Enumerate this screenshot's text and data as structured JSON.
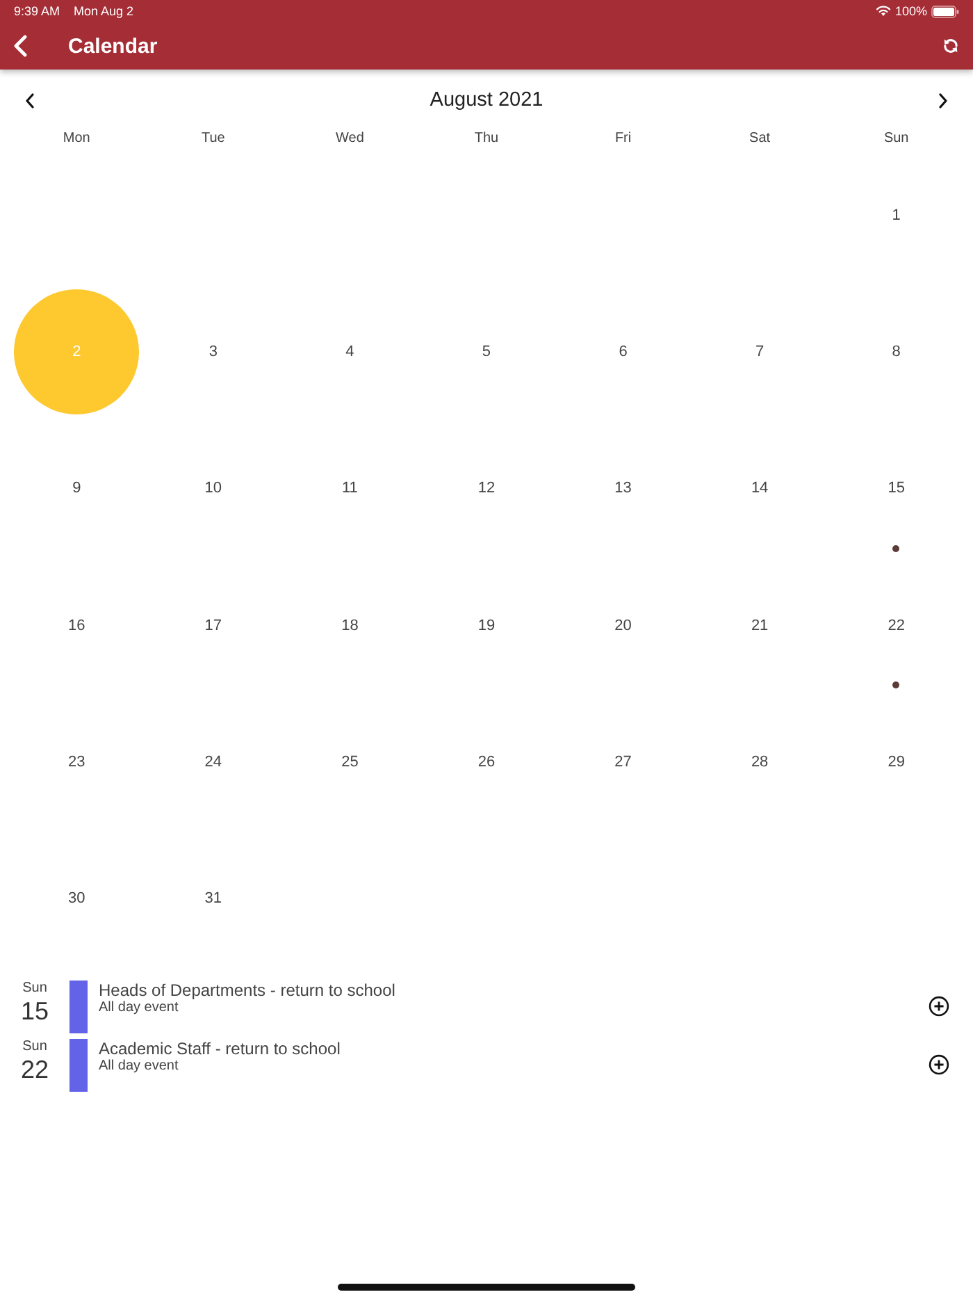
{
  "status_bar": {
    "time": "9:39 AM",
    "date": "Mon Aug 2",
    "battery": "100%"
  },
  "app_bar": {
    "title": "Calendar"
  },
  "calendar": {
    "month": "August 2021",
    "weekdays": [
      "Mon",
      "Tue",
      "Wed",
      "Thu",
      "Fri",
      "Sat",
      "Sun"
    ],
    "weeks": [
      {
        "days": [
          {
            "kind": "blank"
          },
          {
            "kind": "blank"
          },
          {
            "kind": "blank"
          },
          {
            "kind": "blank"
          },
          {
            "kind": "blank"
          },
          {
            "kind": "blank"
          },
          {
            "kind": "date",
            "label": "1",
            "selected": false,
            "has_event": false
          }
        ]
      },
      {
        "days": [
          {
            "kind": "date",
            "label": "2",
            "selected": true,
            "has_event": false
          },
          {
            "kind": "date",
            "label": "3",
            "selected": false,
            "has_event": false
          },
          {
            "kind": "date",
            "label": "4",
            "selected": false,
            "has_event": false
          },
          {
            "kind": "date",
            "label": "5",
            "selected": false,
            "has_event": false
          },
          {
            "kind": "date",
            "label": "6",
            "selected": false,
            "has_event": false
          },
          {
            "kind": "date",
            "label": "7",
            "selected": false,
            "has_event": false
          },
          {
            "kind": "date",
            "label": "8",
            "selected": false,
            "has_event": false
          }
        ]
      },
      {
        "days": [
          {
            "kind": "date",
            "label": "9",
            "selected": false,
            "has_event": false
          },
          {
            "kind": "date",
            "label": "10",
            "selected": false,
            "has_event": false
          },
          {
            "kind": "date",
            "label": "11",
            "selected": false,
            "has_event": false
          },
          {
            "kind": "date",
            "label": "12",
            "selected": false,
            "has_event": false
          },
          {
            "kind": "date",
            "label": "13",
            "selected": false,
            "has_event": false
          },
          {
            "kind": "date",
            "label": "14",
            "selected": false,
            "has_event": false
          },
          {
            "kind": "date",
            "label": "15",
            "selected": false,
            "has_event": true
          }
        ]
      },
      {
        "days": [
          {
            "kind": "date",
            "label": "16",
            "selected": false,
            "has_event": false
          },
          {
            "kind": "date",
            "label": "17",
            "selected": false,
            "has_event": false
          },
          {
            "kind": "date",
            "label": "18",
            "selected": false,
            "has_event": false
          },
          {
            "kind": "date",
            "label": "19",
            "selected": false,
            "has_event": false
          },
          {
            "kind": "date",
            "label": "20",
            "selected": false,
            "has_event": false
          },
          {
            "kind": "date",
            "label": "21",
            "selected": false,
            "has_event": false
          },
          {
            "kind": "date",
            "label": "22",
            "selected": false,
            "has_event": true
          }
        ]
      },
      {
        "days": [
          {
            "kind": "date",
            "label": "23",
            "selected": false,
            "has_event": false
          },
          {
            "kind": "date",
            "label": "24",
            "selected": false,
            "has_event": false
          },
          {
            "kind": "date",
            "label": "25",
            "selected": false,
            "has_event": false
          },
          {
            "kind": "date",
            "label": "26",
            "selected": false,
            "has_event": false
          },
          {
            "kind": "date",
            "label": "27",
            "selected": false,
            "has_event": false
          },
          {
            "kind": "date",
            "label": "28",
            "selected": false,
            "has_event": false
          },
          {
            "kind": "date",
            "label": "29",
            "selected": false,
            "has_event": false
          }
        ]
      },
      {
        "days": [
          {
            "kind": "date",
            "label": "30",
            "selected": false,
            "has_event": false
          },
          {
            "kind": "date",
            "label": "31",
            "selected": false,
            "has_event": false
          },
          {
            "kind": "blank"
          },
          {
            "kind": "blank"
          },
          {
            "kind": "blank"
          },
          {
            "kind": "blank"
          },
          {
            "kind": "blank"
          }
        ]
      }
    ]
  },
  "events": [
    {
      "weekday": "Sun",
      "day": "15",
      "title": "Heads of Departments - return to school",
      "subtitle": "All day event",
      "color": "#6363e8"
    },
    {
      "weekday": "Sun",
      "day": "22",
      "title": "Academic Staff - return to school",
      "subtitle": "All day event",
      "color": "#6363e8"
    }
  ]
}
